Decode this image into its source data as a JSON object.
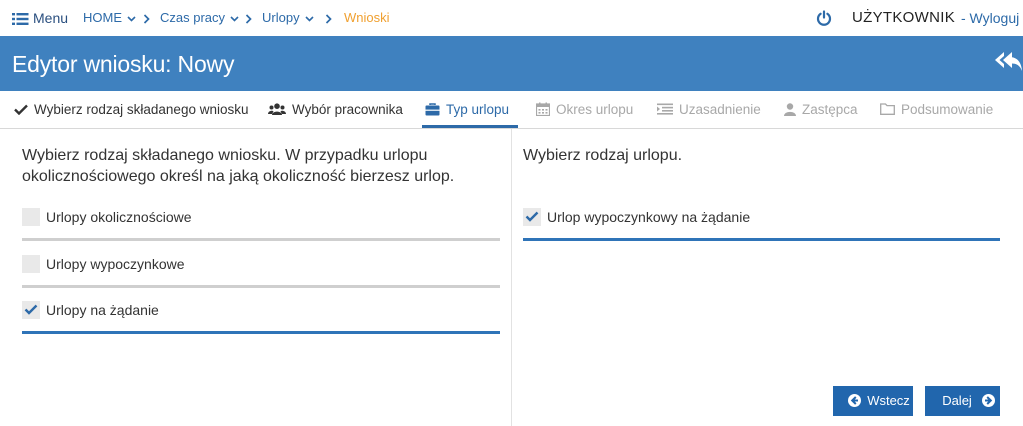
{
  "topnav": {
    "menu_label": "Menu",
    "breadcrumbs": [
      {
        "label": "HOME",
        "dropdown": true
      },
      {
        "label": "Czas pracy",
        "dropdown": true
      },
      {
        "label": "Urlopy",
        "dropdown": true
      },
      {
        "label": "Wnioski",
        "dropdown": false,
        "active": true
      }
    ],
    "username": "UŻYTKOWNIK",
    "logout_label": "- Wyloguj"
  },
  "header": {
    "title": "Edytor wniosku: Nowy"
  },
  "tabs": [
    {
      "label": "Wybierz rodzaj składanego wniosku",
      "icon": "check-icon",
      "state": "done"
    },
    {
      "label": "Wybór pracownika",
      "icon": "users-icon",
      "state": "done"
    },
    {
      "label": "Typ urlopu",
      "icon": "briefcase-icon",
      "state": "active"
    },
    {
      "label": "Okres urlopu",
      "icon": "calendar-icon",
      "state": "disabled"
    },
    {
      "label": "Uzasadnienie",
      "icon": "list-icon",
      "state": "disabled"
    },
    {
      "label": "Zastępca",
      "icon": "user-icon",
      "state": "disabled"
    },
    {
      "label": "Podsumowanie",
      "icon": "folder-icon",
      "state": "disabled"
    }
  ],
  "left_panel": {
    "intro_line1": "Wybierz rodzaj składanego wniosku. W przypadku urlopu",
    "intro_line2": "okolicznościowego określ na jaką okoliczność bierzesz urlop.",
    "options": [
      {
        "label": "Urlopy okolicznościowe",
        "checked": false
      },
      {
        "label": "Urlopy wypoczynkowe",
        "checked": false
      },
      {
        "label": "Urlopy na żądanie",
        "checked": true
      }
    ]
  },
  "right_panel": {
    "intro": "Wybierz rodzaj urlopu.",
    "options": [
      {
        "label": "Urlop wypoczynkowy na żądanie",
        "checked": true
      }
    ]
  },
  "buttons": {
    "back_label": "Wstecz",
    "next_label": "Dalej"
  },
  "colors": {
    "brand": "#3f81bf",
    "accent": "#2d6aa8",
    "active_crumb": "#f0a030",
    "button": "#2166ad"
  }
}
